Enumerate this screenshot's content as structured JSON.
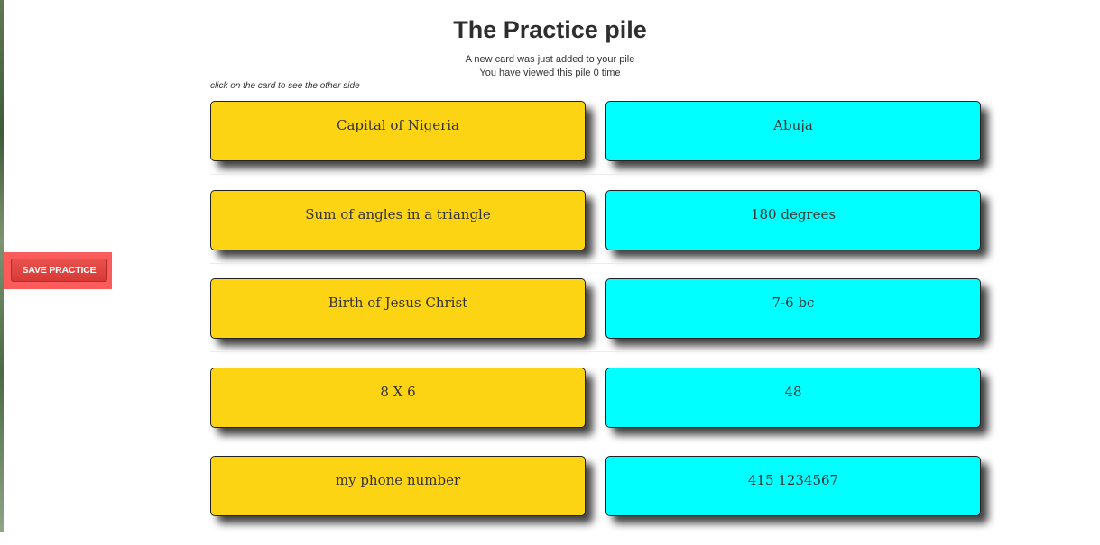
{
  "header": {
    "title": "The Practice pile",
    "status_line": "A new card was just added to your pile",
    "view_count_line": "You have viewed this pile 0 time",
    "hint": "click on the card to see the other side"
  },
  "sidebar": {
    "save_label": "SAVE PRACTICE"
  },
  "colors": {
    "front_card": "#fdd414",
    "back_card": "#00ffff",
    "save_button": "#d63a36",
    "save_highlight": "#fb5b5b"
  },
  "cards": [
    {
      "front": "Capital of Nigeria",
      "back": "Abuja"
    },
    {
      "front": "Sum of angles in a triangle",
      "back": "180 degrees"
    },
    {
      "front": "Birth of Jesus Christ",
      "back": "7-6 bc"
    },
    {
      "front": "8 X 6",
      "back": "48"
    },
    {
      "front": "my phone number",
      "back": "415 1234567"
    }
  ]
}
